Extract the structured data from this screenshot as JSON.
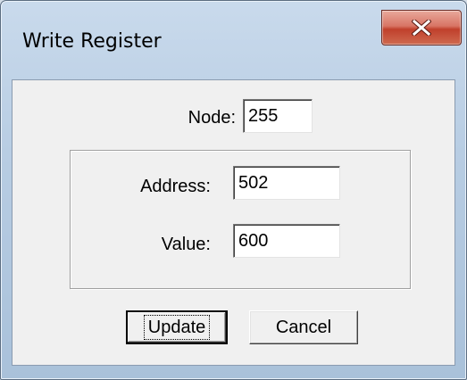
{
  "window": {
    "title": "Write Register",
    "close_icon": "close-icon"
  },
  "form": {
    "node": {
      "label": "Node:",
      "value": "255"
    },
    "address": {
      "label": "Address:",
      "value": "502"
    },
    "value": {
      "label": "Value:",
      "value": "600"
    }
  },
  "buttons": {
    "update_label": "Update",
    "cancel_label": "Cancel"
  },
  "colors": {
    "close_button": "#c0402c",
    "client_background": "#f0f0f0"
  }
}
